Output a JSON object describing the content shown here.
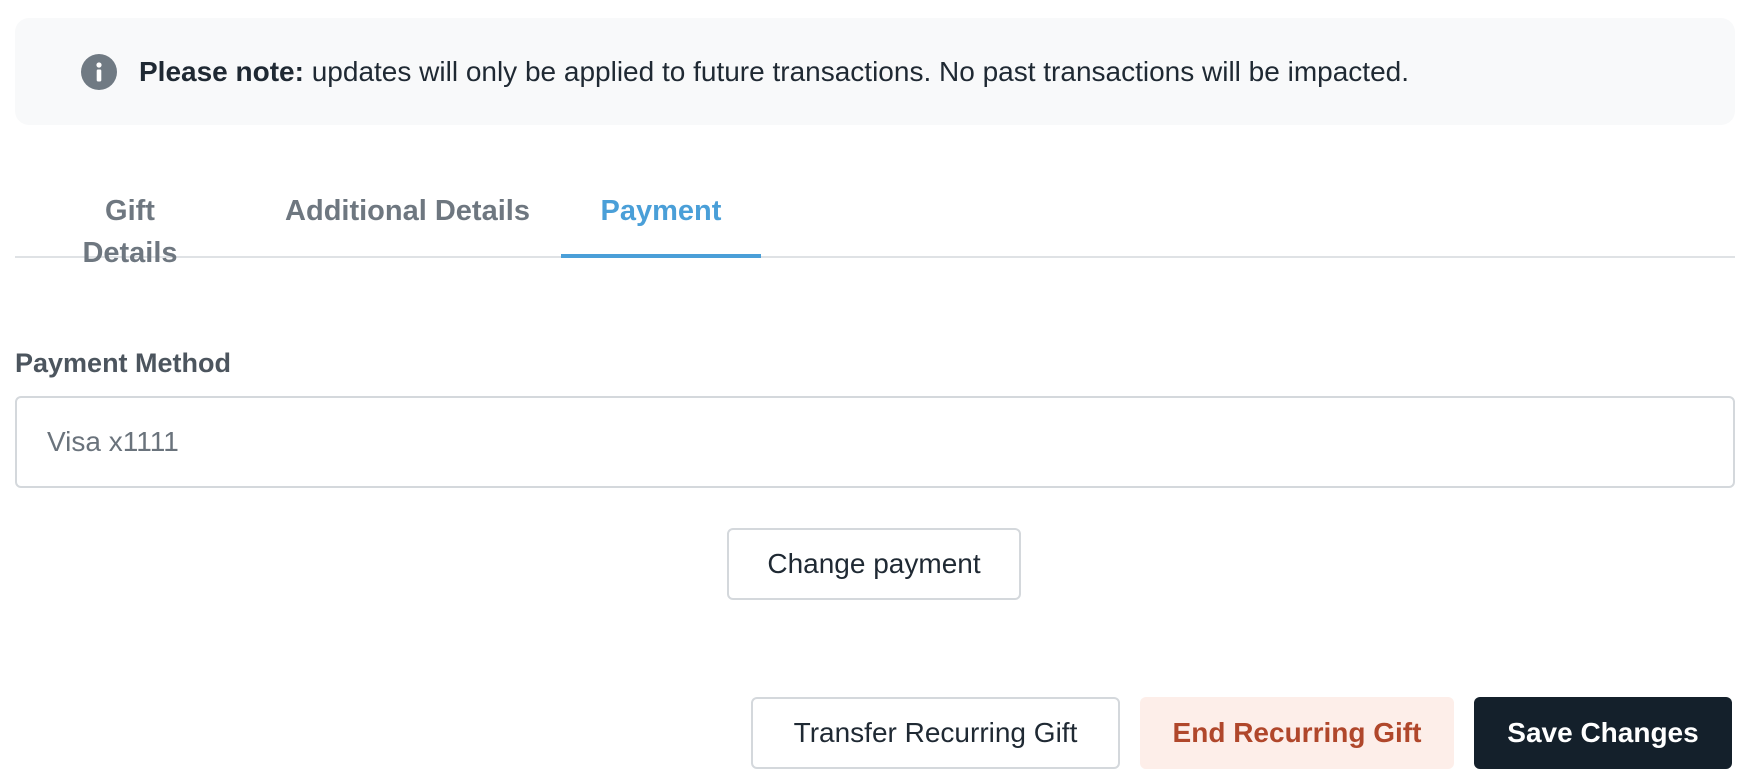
{
  "notice": {
    "icon": "info-icon",
    "bold_text": "Please note:",
    "message": " updates will only be applied to future transactions. No past transactions will be impacted."
  },
  "tabs": [
    {
      "label": "Gift Details",
      "active": false
    },
    {
      "label": "Additional Details",
      "active": false
    },
    {
      "label": "Payment",
      "active": true
    }
  ],
  "payment": {
    "label": "Payment Method",
    "value": "Visa x1111",
    "change_label": "Change payment"
  },
  "actions": {
    "transfer_label": "Transfer Recurring Gift",
    "end_label": "End Recurring Gift",
    "save_label": "Save Changes"
  },
  "colors": {
    "accent": "#4a9fd8",
    "danger_text": "#b0472b",
    "danger_bg": "#fdeee9",
    "primary_bg": "#14202b"
  }
}
